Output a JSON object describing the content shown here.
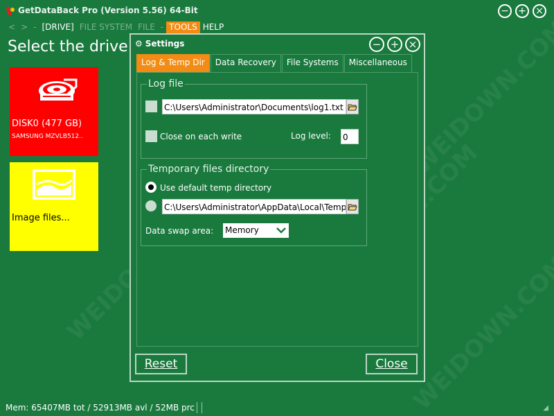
{
  "app": {
    "title": "GetDataBack Pro (Version 5.56) 64-Bit",
    "window_buttons": {
      "minimize": "−",
      "maximize": "+",
      "close": "×"
    }
  },
  "menu": {
    "back": "<",
    "forward": ">",
    "sep": "-",
    "items": [
      "[DRIVE]",
      "FILE SYSTEM",
      "FILE",
      "-",
      "TOOLS",
      "HELP"
    ]
  },
  "page": {
    "heading": "Select the drive you"
  },
  "tiles": [
    {
      "label": "DISK0 (477 GB)",
      "sub": "SAMSUNG MZVLB512.."
    },
    {
      "label": "Image files..."
    }
  ],
  "status": {
    "text": "Mem: 65407MB tot / 52913MB avl / 52MB prc"
  },
  "watermark": "WEIDOWN.COM",
  "dialog": {
    "title": "Settings",
    "buttons": {
      "minimize": "−",
      "maximize": "+",
      "close": "×"
    },
    "tabs": [
      "Log & Temp Dir",
      "Data Recovery",
      "File Systems",
      "Miscellaneous"
    ],
    "selected_tab": 0,
    "log_group": {
      "legend": "Log file",
      "path": "C:\\Users\\Administrator\\Documents\\log1.txt",
      "close_each_write": "Close on each write",
      "log_level_label": "Log level:",
      "log_level_value": "0"
    },
    "temp_group": {
      "legend": "Temporary files directory",
      "use_default": "Use default temp directory",
      "path": "C:\\Users\\Administrator\\AppData\\Local\\Temp",
      "swap_label": "Data swap area:",
      "swap_value": "Memory"
    },
    "reset": "Reset",
    "close": "Close"
  },
  "colors": {
    "background": "#1a7a3e",
    "accent": "#f28c14",
    "disk_tile": "#ff0000",
    "image_tile": "#ffff00"
  }
}
